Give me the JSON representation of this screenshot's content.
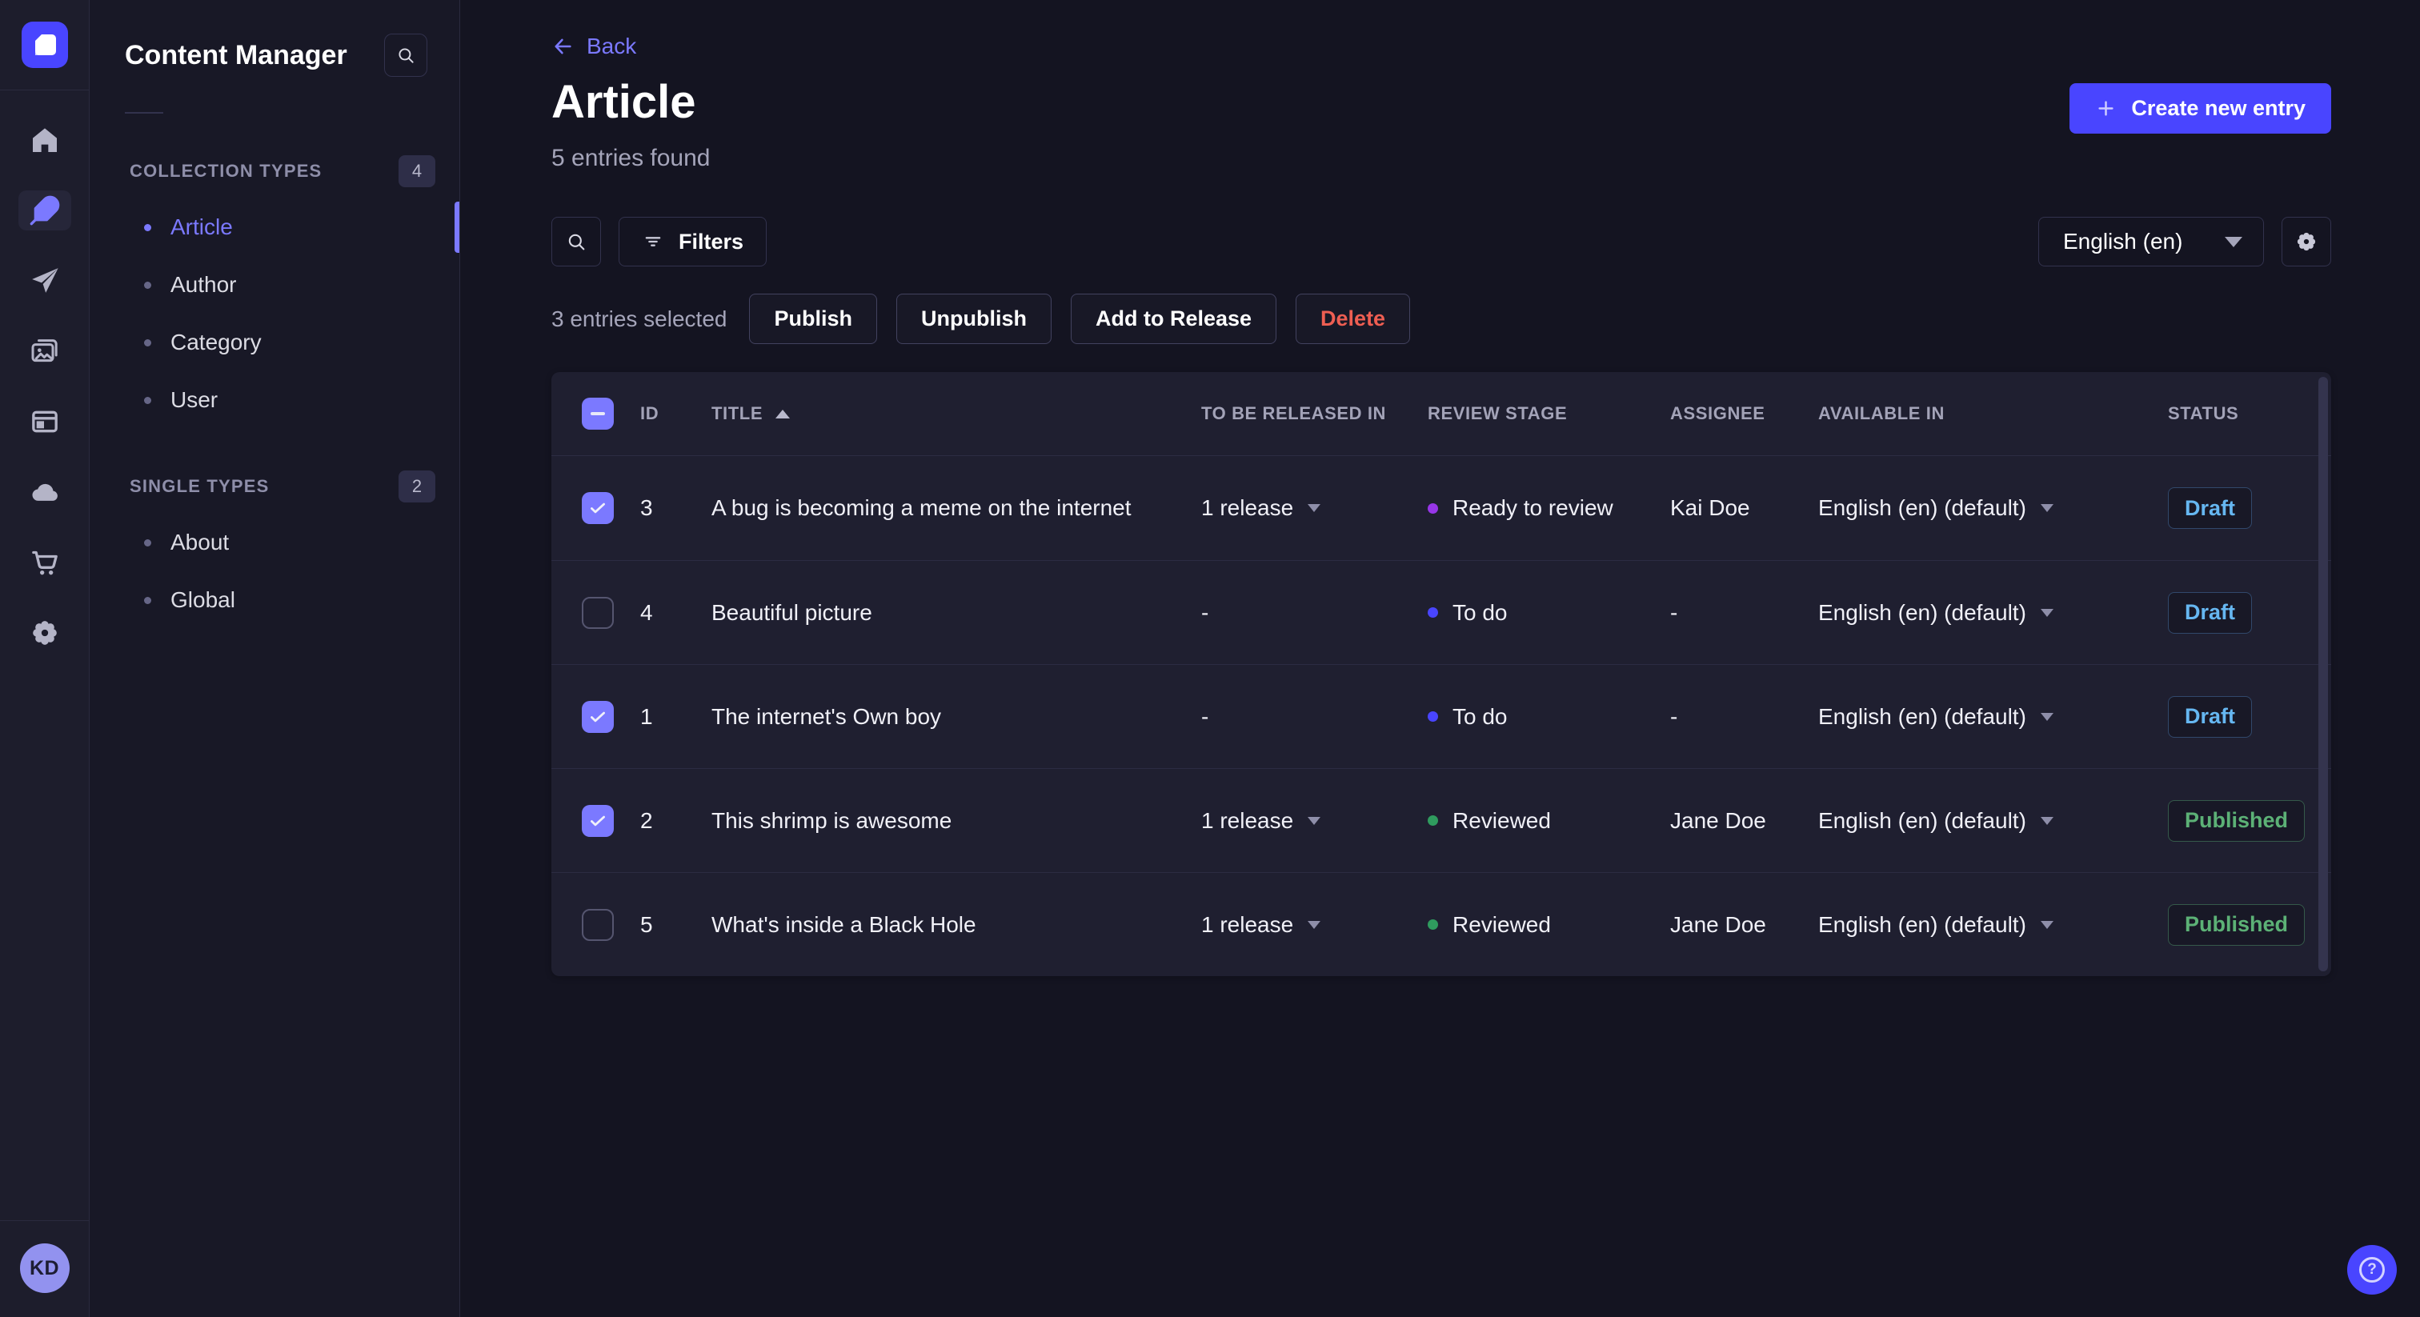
{
  "nav_rail": {
    "icons": [
      "strapi-logo",
      "home",
      "content-manager",
      "releases",
      "media-library",
      "content-type-builder",
      "deploy",
      "marketplace",
      "settings"
    ],
    "active_icon": "content-manager",
    "avatar_initials": "KD"
  },
  "sidebar": {
    "title": "Content Manager",
    "sections": [
      {
        "label": "COLLECTION TYPES",
        "count": "4",
        "items": [
          {
            "label": "Article",
            "active": true
          },
          {
            "label": "Author",
            "active": false
          },
          {
            "label": "Category",
            "active": false
          },
          {
            "label": "User",
            "active": false
          }
        ]
      },
      {
        "label": "SINGLE TYPES",
        "count": "2",
        "items": [
          {
            "label": "About",
            "active": false
          },
          {
            "label": "Global",
            "active": false
          }
        ]
      }
    ]
  },
  "header": {
    "back_label": "Back",
    "title": "Article",
    "subtitle": "5 entries found",
    "create_button": "Create new entry"
  },
  "toolbar": {
    "filters_label": "Filters",
    "locale": "English (en)"
  },
  "selection": {
    "text": "3 entries selected",
    "actions": [
      "Publish",
      "Unpublish",
      "Add to Release",
      "Delete"
    ]
  },
  "table": {
    "headers": [
      "ID",
      "TITLE",
      "TO BE RELEASED IN",
      "REVIEW STAGE",
      "ASSIGNEE",
      "AVAILABLE IN",
      "STATUS"
    ],
    "sort_column": "TITLE",
    "sort_direction": "asc",
    "header_checkbox_state": "indeterminate",
    "rows": [
      {
        "checked": true,
        "id": "3",
        "title": "A bug is becoming a meme on the internet",
        "to_be_released_in": "1 release",
        "review_stage": "Ready to review",
        "stage_color": "#9736e8",
        "assignee": "Kai Doe",
        "available_in": "English (en) (default)",
        "status": "Draft"
      },
      {
        "checked": false,
        "id": "4",
        "title": "Beautiful picture",
        "to_be_released_in": "-",
        "review_stage": "To do",
        "stage_color": "#4945ff",
        "assignee": "-",
        "available_in": "English (en) (default)",
        "status": "Draft"
      },
      {
        "checked": true,
        "id": "1",
        "title": "The internet's Own boy",
        "to_be_released_in": "-",
        "review_stage": "To do",
        "stage_color": "#4945ff",
        "assignee": "-",
        "available_in": "English (en) (default)",
        "status": "Draft"
      },
      {
        "checked": true,
        "id": "2",
        "title": "This shrimp is awesome",
        "to_be_released_in": "1 release",
        "review_stage": "Reviewed",
        "stage_color": "#2f9b5e",
        "assignee": "Jane Doe",
        "available_in": "English (en) (default)",
        "status": "Published"
      },
      {
        "checked": false,
        "id": "5",
        "title": "What's inside a Black Hole",
        "to_be_released_in": "1 release",
        "review_stage": "Reviewed",
        "stage_color": "#2f9b5e",
        "assignee": "Jane Doe",
        "available_in": "English (en) (default)",
        "status": "Published"
      }
    ]
  },
  "colors": {
    "primary": "#4945ff",
    "link": "#7b79ff",
    "draft": "#66b7f1",
    "published": "#5cb176",
    "danger": "#ee5e52"
  },
  "help": {
    "label": "?"
  }
}
